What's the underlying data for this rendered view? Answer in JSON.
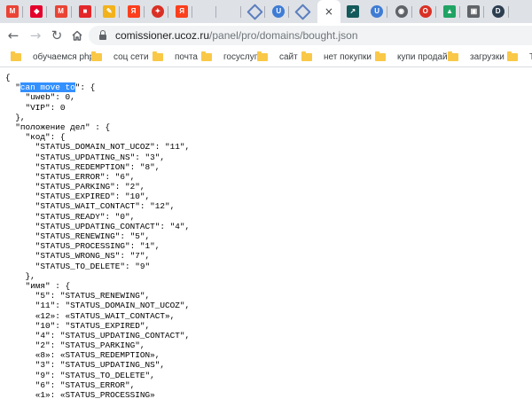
{
  "browser": {
    "tabs": [
      {
        "icon": "gmail-icon",
        "color": "#ea4335"
      },
      {
        "icon": "red-cube-icon",
        "color": "#e4002b"
      },
      {
        "icon": "gmail-icon",
        "color": "#ea4335"
      },
      {
        "icon": "red-logo-icon",
        "color": "#e3272b"
      },
      {
        "icon": "yellow-pencil-icon",
        "color": "#f2b21c"
      },
      {
        "icon": "yandex-icon",
        "color": "#fc3f1d"
      },
      {
        "icon": "red-circle-icon",
        "color": "#d93025"
      },
      {
        "icon": "yandex-icon",
        "color": "#fc3f1d"
      },
      {
        "icon": "microsoft-icon"
      },
      {
        "icon": "microsoft-icon"
      },
      {
        "icon": "diamond-icon",
        "color": "#5b7fbf"
      },
      {
        "icon": "ucoz-u-icon",
        "color": "#3f7cd4"
      },
      {
        "icon": "diamond-icon",
        "color": "#5b7fbf"
      },
      {
        "icon": "chart-icon",
        "color": "#145a5a"
      },
      {
        "icon": "ucoz-u-icon",
        "color": "#3f7cd4"
      },
      {
        "icon": "globe-icon",
        "color": "#5f6368"
      },
      {
        "icon": "red-o-icon",
        "color": "#d93025"
      },
      {
        "icon": "google-drive-icon",
        "color": "#1fa463"
      },
      {
        "icon": "gray-box-icon",
        "color": "#5f6368"
      },
      {
        "icon": "dark-d-icon",
        "color": "#2c3e50"
      }
    ],
    "active_tab_close": "×",
    "url_host": "comissioner.ucoz.ru",
    "url_path": "/panel/pro/domains/bought.json",
    "bookmarks": [
      "обучаемся php",
      "соц сети",
      "почта",
      "госуслуги",
      "сайт",
      "нет покупки",
      "купи продай",
      "загрузки",
      "Так"
    ]
  },
  "json_lines": [
    "{",
    "  \"can move to\": {",
    "    \"uweb\": 0,",
    "    \"VIP\": 0",
    "  },",
    "  \"положение дел\" : {",
    "    \"код\": {",
    "      \"STATUS_DOMAIN_NOT_UCOZ\": \"11\",",
    "      \"STATUS_UPDATING_NS\": \"3\",",
    "      \"STATUS_REDEMPTION\": \"8\",",
    "      \"STATUS_ERROR\": \"6\",",
    "      \"STATUS_PARKING\": \"2\",",
    "      \"STATUS_EXPIRED\": \"10\",",
    "      \"STATUS_WAIT_CONTACT\": \"12\",",
    "      \"STATUS_READY\": \"0\",",
    "      \"STATUS_UPDATING_CONTACT\": \"4\",",
    "      \"STATUS_RENEWING\": \"5\",",
    "      \"STATUS_PROCESSING\": \"1\",",
    "      \"STATUS_WRONG_NS\": \"7\",",
    "      \"STATUS_TO_DELETE\": \"9\"",
    "    },",
    "    \"имя\" : {",
    "      \"5\": \"STATUS_RENEWING\",",
    "      \"11\": \"STATUS_DOMAIN_NOT_UCOZ\",",
    "      «12»: «STATUS_WAIT_CONTACT»,",
    "      \"10\": \"STATUS_EXPIRED\",",
    "      \"4\": \"STATUS_UPDATING_CONTACT\",",
    "      \"2\": \"STATUS_PARKING\",",
    "      «8»: «STATUS_REDEMPTION»,",
    "      \"3\": \"STATUS_UPDATING_NS\",",
    "      \"9\": \"STATUS_TO_DELETE\",",
    "      \"6\": \"STATUS_ERROR\",",
    "      «1»: «STATUS_PROCESSING»"
  ],
  "selection": "can move to"
}
